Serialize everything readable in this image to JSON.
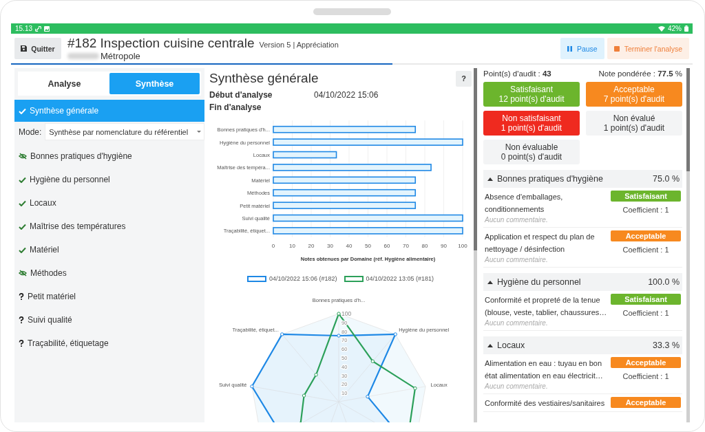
{
  "status_bar": {
    "time": "15.13",
    "battery": "42%"
  },
  "header": {
    "quit_button": "Quitter",
    "title": "#182 Inspection cuisine centrale",
    "version": "Version 5 | Appréciation",
    "subtitle": "Métropole",
    "buttons": [
      {
        "label": "Pause",
        "kind": "pause"
      },
      {
        "label": "Terminer l'analyse",
        "kind": "stop"
      }
    ],
    "progress": {
      "level": 0.56
    }
  },
  "tabs": [
    {
      "label": "Analyse",
      "selected": false
    },
    {
      "label": "Synthèse",
      "selected": true
    }
  ],
  "sidebar": {
    "summary_item": {
      "label": "Synthèse générale",
      "selected": true
    },
    "mode": {
      "label": "Mode:",
      "value": "Synthèse par nomenclature du référentiel"
    },
    "domains": [
      {
        "label": "Bonnes pratiques d'hygiène",
        "kind": "hidden",
        "selected": false
      },
      {
        "label": "Hygiène du personnel",
        "kind": "done",
        "selected": false
      },
      {
        "label": "Locaux",
        "kind": "done",
        "selected": false
      },
      {
        "label": "Maîtrise des températures",
        "kind": "done",
        "selected": false
      },
      {
        "label": "Matériel",
        "kind": "done",
        "selected": false
      },
      {
        "label": "Méthodes",
        "kind": "hidden",
        "selected": false
      },
      {
        "label": "Petit matériel",
        "kind": "unknown",
        "selected": false
      },
      {
        "label": "Suivi qualité",
        "kind": "unknown",
        "selected": false
      },
      {
        "label": "Traçabilité, étiquetage",
        "kind": "unknown",
        "selected": false
      }
    ]
  },
  "main": {
    "title": "Synthèse générale",
    "help_button": "?",
    "fields": [
      {
        "label": "Début d'analyse",
        "value": "04/10/2022 15:06"
      },
      {
        "label": "Fin d'analyse"
      }
    ],
    "chart_data": {
      "type": "bar",
      "orientation": "horizontal",
      "xlabel": "Notes obtenues par Domaine (réf. Hygiène alimentaire)",
      "categories": [
        "Bonnes pratiques d'h...",
        "Hygiène du personnel",
        "Locaux",
        "Maîtrise des tempéra...",
        "Matériel",
        "Méthodes",
        "Petit matériel",
        "Suivi qualité",
        "Traçabilité, étiquet..."
      ],
      "series": [
        {
          "name": "04/10/2022 15:06 (#182)",
          "color": "#1e88e5",
          "values": [
            75,
            100,
            33.3,
            83.3,
            75,
            75,
            75,
            100,
            100
          ]
        },
        {
          "name": "04/10/2022 13:05 (#181)",
          "color": "#2ca05a",
          "values": [
            null,
            null,
            null,
            null,
            null,
            null,
            null,
            null,
            null
          ]
        }
      ],
      "xlim": [
        0,
        100
      ],
      "xticks": [
        0,
        10,
        20,
        30,
        40,
        50,
        60,
        70,
        80,
        90,
        100
      ],
      "grid": true
    },
    "radar": {
      "axis_labels": [
        "Bonnes pratiques d'h...",
        "Hygiène du personnel",
        "Locaux",
        "Suivi qualité",
        "Traçabilité, étiquet..."
      ],
      "ticks": [
        "100",
        "90",
        "80",
        "70",
        "60",
        "50",
        "40",
        "30",
        "20",
        "10"
      ]
    }
  },
  "results": {
    "audit_points": "Point(s) d'audit : **43**",
    "weighted_score": "Note pondérée : **77.5** %",
    "tiles": [
      {
        "label": "Satisfaisant",
        "count": "12 point(s) d'audit",
        "color": "#6cb52d"
      },
      {
        "label": "Acceptable",
        "count": "7 point(s) d'audit",
        "color": "#f7891f"
      },
      {
        "label": "Non satisfaisant",
        "count": "1 point(s) d'audit",
        "color": "#ef2a1f"
      },
      {
        "label": "Non évalué",
        "count": "1 point(s) d'audit",
        "color": "#f3f4f5"
      },
      {
        "label": "Non évaluable",
        "count": "0 point(s) d'audit",
        "color": "#f3f4f5"
      }
    ],
    "sections": [
      {
        "title": "Bonnes pratiques d'hygiène",
        "score": "75.0 %",
        "expanded": true,
        "items": [
          {
            "lines": [
              "Absence d'emballages,",
              "conditionnements"
            ],
            "status": "Satisfaisant",
            "color": "#6cb52d",
            "coefficient": "Coefficient : 1",
            "comment": "Aucun commentaire."
          },
          {
            "lines": [
              "Application et respect du plan de",
              "nettoyage / désinfection"
            ],
            "status": "Acceptable",
            "color": "#f7891f",
            "coefficient": "Coefficient : 1",
            "comment": "Aucun commentaire."
          }
        ]
      },
      {
        "title": "Hygiène du personnel",
        "score": "100.0 %",
        "expanded": true,
        "items": [
          {
            "lines": [
              "Conformité et propreté de la tenue",
              "(blouse, veste, tablier, chaussures…"
            ],
            "status": "Satisfaisant",
            "color": "#6cb52d",
            "coefficient": "Coefficient : 1",
            "comment": "Aucun commentaire."
          }
        ]
      },
      {
        "title": "Locaux",
        "score": "33.3 %",
        "expanded": true,
        "items": [
          {
            "lines": [
              "Alimentation en eau : tuyau en bon",
              "état alimentation en eau électricit…"
            ],
            "status": "Acceptable",
            "color": "#f7891f",
            "coefficient": "Coefficient : 1",
            "comment": "Aucun commentaire."
          },
          {
            "lines": [
              "Conformité des vestiaires/sanitaires"
            ],
            "status": "Acceptable",
            "color": "#f7891f"
          }
        ]
      }
    ]
  }
}
